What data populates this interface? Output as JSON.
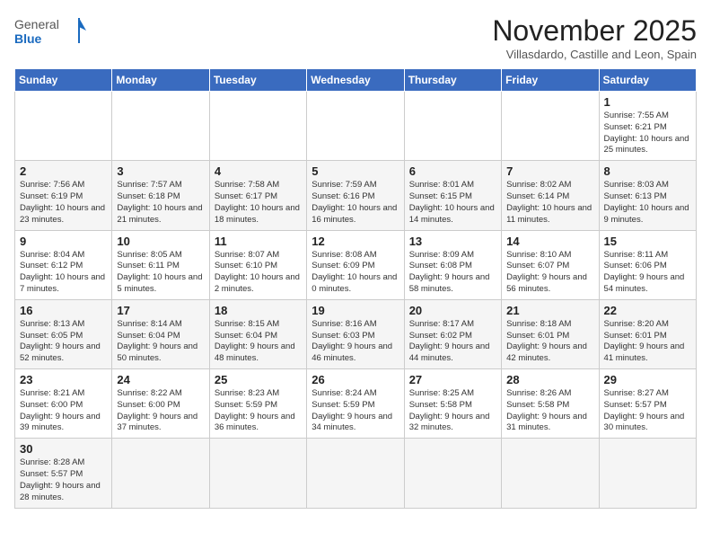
{
  "header": {
    "logo_general": "General",
    "logo_blue": "Blue",
    "title": "November 2025",
    "subtitle": "Villasdardo, Castille and Leon, Spain"
  },
  "weekdays": [
    "Sunday",
    "Monday",
    "Tuesday",
    "Wednesday",
    "Thursday",
    "Friday",
    "Saturday"
  ],
  "weeks": [
    [
      {
        "day": "",
        "info": ""
      },
      {
        "day": "",
        "info": ""
      },
      {
        "day": "",
        "info": ""
      },
      {
        "day": "",
        "info": ""
      },
      {
        "day": "",
        "info": ""
      },
      {
        "day": "",
        "info": ""
      },
      {
        "day": "1",
        "info": "Sunrise: 7:55 AM\nSunset: 6:21 PM\nDaylight: 10 hours\nand 25 minutes."
      }
    ],
    [
      {
        "day": "2",
        "info": "Sunrise: 7:56 AM\nSunset: 6:19 PM\nDaylight: 10 hours\nand 23 minutes."
      },
      {
        "day": "3",
        "info": "Sunrise: 7:57 AM\nSunset: 6:18 PM\nDaylight: 10 hours\nand 21 minutes."
      },
      {
        "day": "4",
        "info": "Sunrise: 7:58 AM\nSunset: 6:17 PM\nDaylight: 10 hours\nand 18 minutes."
      },
      {
        "day": "5",
        "info": "Sunrise: 7:59 AM\nSunset: 6:16 PM\nDaylight: 10 hours\nand 16 minutes."
      },
      {
        "day": "6",
        "info": "Sunrise: 8:01 AM\nSunset: 6:15 PM\nDaylight: 10 hours\nand 14 minutes."
      },
      {
        "day": "7",
        "info": "Sunrise: 8:02 AM\nSunset: 6:14 PM\nDaylight: 10 hours\nand 11 minutes."
      },
      {
        "day": "8",
        "info": "Sunrise: 8:03 AM\nSunset: 6:13 PM\nDaylight: 10 hours\nand 9 minutes."
      }
    ],
    [
      {
        "day": "9",
        "info": "Sunrise: 8:04 AM\nSunset: 6:12 PM\nDaylight: 10 hours\nand 7 minutes."
      },
      {
        "day": "10",
        "info": "Sunrise: 8:05 AM\nSunset: 6:11 PM\nDaylight: 10 hours\nand 5 minutes."
      },
      {
        "day": "11",
        "info": "Sunrise: 8:07 AM\nSunset: 6:10 PM\nDaylight: 10 hours\nand 2 minutes."
      },
      {
        "day": "12",
        "info": "Sunrise: 8:08 AM\nSunset: 6:09 PM\nDaylight: 10 hours\nand 0 minutes."
      },
      {
        "day": "13",
        "info": "Sunrise: 8:09 AM\nSunset: 6:08 PM\nDaylight: 9 hours\nand 58 minutes."
      },
      {
        "day": "14",
        "info": "Sunrise: 8:10 AM\nSunset: 6:07 PM\nDaylight: 9 hours\nand 56 minutes."
      },
      {
        "day": "15",
        "info": "Sunrise: 8:11 AM\nSunset: 6:06 PM\nDaylight: 9 hours\nand 54 minutes."
      }
    ],
    [
      {
        "day": "16",
        "info": "Sunrise: 8:13 AM\nSunset: 6:05 PM\nDaylight: 9 hours\nand 52 minutes."
      },
      {
        "day": "17",
        "info": "Sunrise: 8:14 AM\nSunset: 6:04 PM\nDaylight: 9 hours\nand 50 minutes."
      },
      {
        "day": "18",
        "info": "Sunrise: 8:15 AM\nSunset: 6:04 PM\nDaylight: 9 hours\nand 48 minutes."
      },
      {
        "day": "19",
        "info": "Sunrise: 8:16 AM\nSunset: 6:03 PM\nDaylight: 9 hours\nand 46 minutes."
      },
      {
        "day": "20",
        "info": "Sunrise: 8:17 AM\nSunset: 6:02 PM\nDaylight: 9 hours\nand 44 minutes."
      },
      {
        "day": "21",
        "info": "Sunrise: 8:18 AM\nSunset: 6:01 PM\nDaylight: 9 hours\nand 42 minutes."
      },
      {
        "day": "22",
        "info": "Sunrise: 8:20 AM\nSunset: 6:01 PM\nDaylight: 9 hours\nand 41 minutes."
      }
    ],
    [
      {
        "day": "23",
        "info": "Sunrise: 8:21 AM\nSunset: 6:00 PM\nDaylight: 9 hours\nand 39 minutes."
      },
      {
        "day": "24",
        "info": "Sunrise: 8:22 AM\nSunset: 6:00 PM\nDaylight: 9 hours\nand 37 minutes."
      },
      {
        "day": "25",
        "info": "Sunrise: 8:23 AM\nSunset: 5:59 PM\nDaylight: 9 hours\nand 36 minutes."
      },
      {
        "day": "26",
        "info": "Sunrise: 8:24 AM\nSunset: 5:59 PM\nDaylight: 9 hours\nand 34 minutes."
      },
      {
        "day": "27",
        "info": "Sunrise: 8:25 AM\nSunset: 5:58 PM\nDaylight: 9 hours\nand 32 minutes."
      },
      {
        "day": "28",
        "info": "Sunrise: 8:26 AM\nSunset: 5:58 PM\nDaylight: 9 hours\nand 31 minutes."
      },
      {
        "day": "29",
        "info": "Sunrise: 8:27 AM\nSunset: 5:57 PM\nDaylight: 9 hours\nand 30 minutes."
      }
    ],
    [
      {
        "day": "30",
        "info": "Sunrise: 8:28 AM\nSunset: 5:57 PM\nDaylight: 9 hours\nand 28 minutes."
      },
      {
        "day": "",
        "info": ""
      },
      {
        "day": "",
        "info": ""
      },
      {
        "day": "",
        "info": ""
      },
      {
        "day": "",
        "info": ""
      },
      {
        "day": "",
        "info": ""
      },
      {
        "day": "",
        "info": ""
      }
    ]
  ]
}
